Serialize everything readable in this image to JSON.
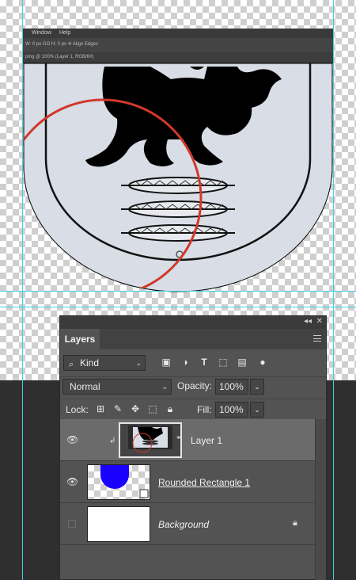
{
  "app_menu": {
    "window": "Window",
    "help": "Help"
  },
  "doc_tab": "ping @ 100% (Layer 1, RGB/8#)",
  "options_bar_text": "W: 0 px   GO H: 0 px   ✣   Align Edges",
  "panel": {
    "tab_label": "Layers",
    "filter_kind": "Kind",
    "blend_mode": "Normal",
    "opacity_label": "Opacity:",
    "opacity_value": "100%",
    "lock_label": "Lock:",
    "fill_label": "Fill:",
    "fill_value": "100%"
  },
  "layers": [
    {
      "name": "Layer 1",
      "selected": true,
      "visible": true,
      "clipped": true
    },
    {
      "name": "Rounded Rectangle 1",
      "selected": false,
      "visible": true,
      "shape_color": "#1a00ff"
    },
    {
      "name": "Background",
      "selected": false,
      "visible": false,
      "locked": true
    }
  ],
  "colors": {
    "guide": "#3fd1e6",
    "shield_fill": "#d8dde6",
    "circle_stroke": "#d0392b",
    "rect_blue": "#1a00ff"
  },
  "icons": [
    "eye-icon",
    "lock-icon",
    "chain-icon",
    "menu-icon",
    "search-icon",
    "image-filter-icon",
    "adjustment-filter-icon",
    "type-filter-icon",
    "shape-filter-icon",
    "smart-object-filter-icon",
    "lock-pixels-icon",
    "brush-icon",
    "move-icon",
    "artboard-icon",
    "padlock-icon"
  ]
}
